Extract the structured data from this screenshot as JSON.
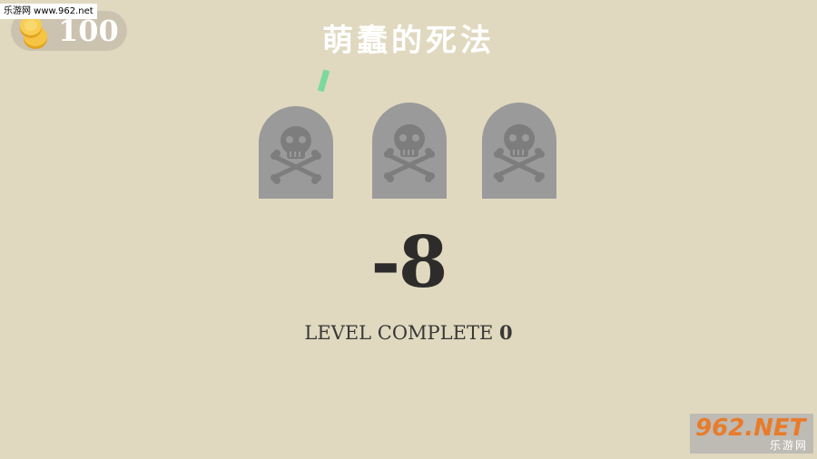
{
  "watermark_top": "乐游网 www.962.net",
  "coins": {
    "count": "100",
    "icon": "coin-stack-icon",
    "coin_color": "#f2b632"
  },
  "title": "萌蠢的死法",
  "tombstones": [
    {
      "icon": "skull-crossbones-icon"
    },
    {
      "icon": "skull-crossbones-icon"
    },
    {
      "icon": "skull-crossbones-icon"
    }
  ],
  "score": "-8",
  "level": {
    "label": "LEVEL COMPLETE",
    "number": "0"
  },
  "watermark_corner": {
    "main": "962.NET",
    "sub": "乐游网"
  },
  "colors": {
    "background": "#e0d9c0",
    "tombstone": "#9a9a9a",
    "tombstone_icon": "#7d7d7d",
    "confetti": "#7cd99c",
    "text_dark": "#2e2c2a"
  }
}
